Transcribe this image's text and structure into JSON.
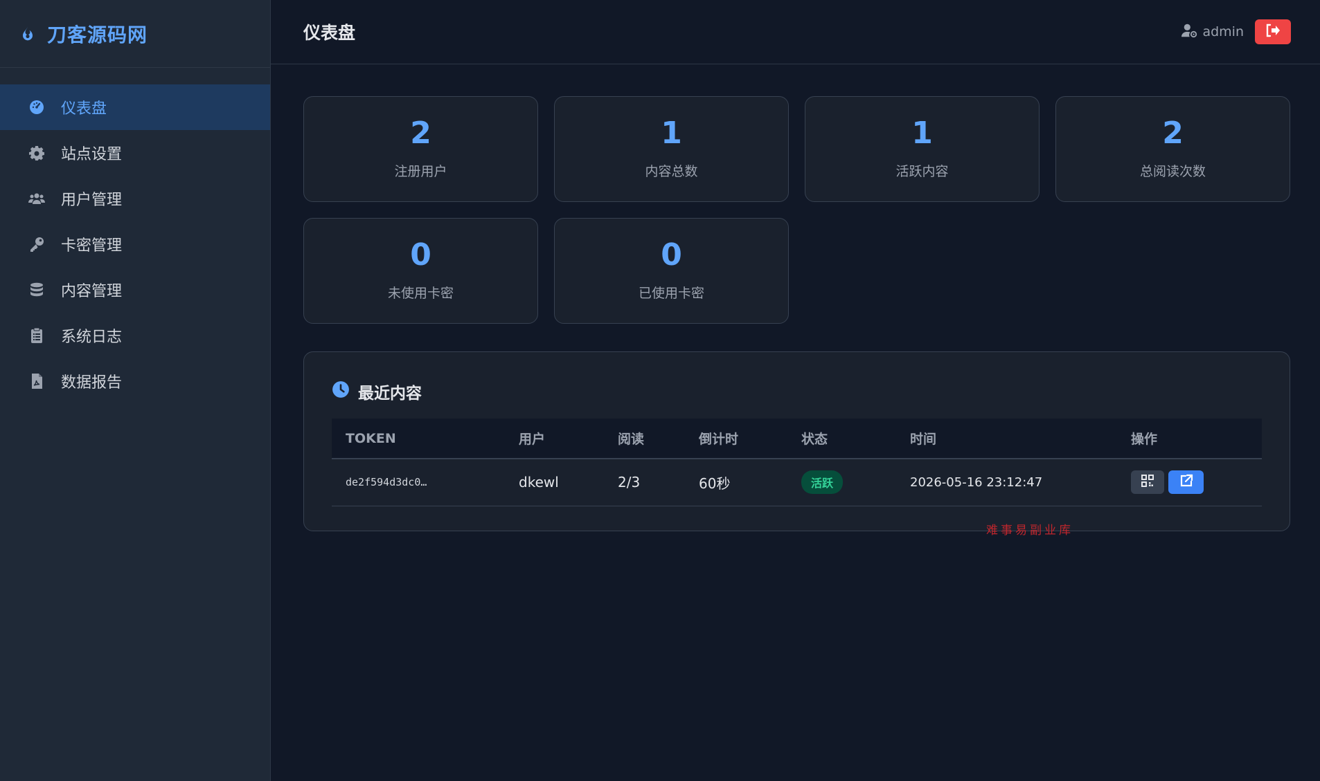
{
  "brand": {
    "name": "刀客源码网",
    "icon": "flame-icon",
    "color": "#60a5fa"
  },
  "sidebar": {
    "items": [
      {
        "label": "仪表盘",
        "icon": "dashboard-icon",
        "active": true
      },
      {
        "label": "站点设置",
        "icon": "gear-icon"
      },
      {
        "label": "用户管理",
        "icon": "users-icon"
      },
      {
        "label": "卡密管理",
        "icon": "key-icon"
      },
      {
        "label": "内容管理",
        "icon": "database-icon"
      },
      {
        "label": "系统日志",
        "icon": "clipboard-icon"
      },
      {
        "label": "数据报告",
        "icon": "file-pdf-icon"
      }
    ]
  },
  "header": {
    "title": "仪表盘",
    "user": "admin",
    "logout_icon": "sign-out-icon"
  },
  "stats": [
    {
      "value": "2",
      "label": "注册用户"
    },
    {
      "value": "1",
      "label": "内容总数"
    },
    {
      "value": "1",
      "label": "活跃内容"
    },
    {
      "value": "2",
      "label": "总阅读次数"
    },
    {
      "value": "0",
      "label": "未使用卡密"
    },
    {
      "value": "0",
      "label": "已使用卡密"
    }
  ],
  "recent": {
    "title": "最近内容",
    "icon": "clock-icon",
    "columns": [
      "TOKEN",
      "用户",
      "阅读",
      "倒计时",
      "状态",
      "时间",
      "操作"
    ],
    "rows": [
      {
        "token": "de2f594d3dc0…",
        "user": "dkewl",
        "reads": "2/3",
        "countdown": "60秒",
        "status": "活跃",
        "time": "2026-05-16 23:12:47",
        "actions": [
          "qrcode-icon",
          "external-link-icon"
        ]
      }
    ]
  },
  "watermark": "难事易副业库",
  "colors": {
    "accent": "#60a5fa",
    "danger": "#ef4444",
    "primary_button": "#3b82f6",
    "badge_bg": "#064e3b",
    "badge_text": "#34d399",
    "watermark": "#c0262d"
  }
}
